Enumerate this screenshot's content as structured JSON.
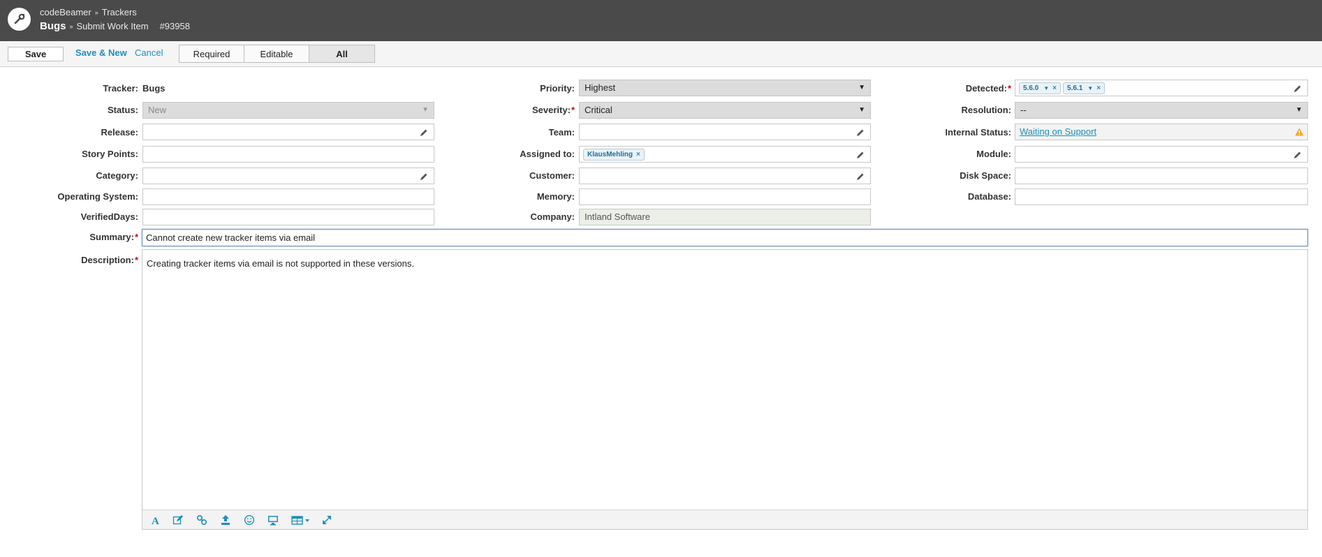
{
  "header": {
    "app": "codeBeamer",
    "section": "Trackers",
    "tracker": "Bugs",
    "page": "Submit Work Item",
    "item_id": "#93958"
  },
  "toolbar": {
    "save_label": "Save",
    "save_new_label": "Save & New",
    "cancel_label": "Cancel",
    "filters": [
      "Required",
      "Editable",
      "All"
    ],
    "active_filter": "All"
  },
  "form": {
    "tracker": {
      "label": "Tracker:",
      "value": "Bugs"
    },
    "status": {
      "label": "Status:",
      "value": "New"
    },
    "release": {
      "label": "Release:",
      "value": ""
    },
    "story_points": {
      "label": "Story Points:",
      "value": ""
    },
    "category": {
      "label": "Category:",
      "value": ""
    },
    "operating_system": {
      "label": "Operating System:",
      "value": ""
    },
    "verified_days": {
      "label": "VerifiedDays:",
      "value": ""
    },
    "priority": {
      "label": "Priority:",
      "value": "Highest"
    },
    "severity": {
      "label": "Severity:",
      "value": "Critical"
    },
    "team": {
      "label": "Team:",
      "value": ""
    },
    "assigned_to": {
      "label": "Assigned to:",
      "chips": [
        "KlausMehling"
      ]
    },
    "customer": {
      "label": "Customer:",
      "value": ""
    },
    "memory": {
      "label": "Memory:",
      "value": ""
    },
    "company": {
      "label": "Company:",
      "value": "Intland Software"
    },
    "detected": {
      "label": "Detected:",
      "chips": [
        "5.6.0",
        "5.6.1"
      ]
    },
    "resolution": {
      "label": "Resolution:",
      "value": "--"
    },
    "internal_status": {
      "label": "Internal Status:",
      "value": "Waiting on Support"
    },
    "module": {
      "label": "Module:",
      "value": ""
    },
    "disk_space": {
      "label": "Disk Space:",
      "value": ""
    },
    "database": {
      "label": "Database:",
      "value": ""
    },
    "summary": {
      "label": "Summary:",
      "value": "Cannot create new tracker items via email"
    },
    "description": {
      "label": "Description:",
      "value": "Creating tracker items via email is not supported in these versions."
    }
  },
  "required_mark": "*",
  "colors": {
    "header_bg": "#4a4a4a",
    "link": "#1b8fbd",
    "required": "#d0021b",
    "warning": "#f5a623"
  }
}
